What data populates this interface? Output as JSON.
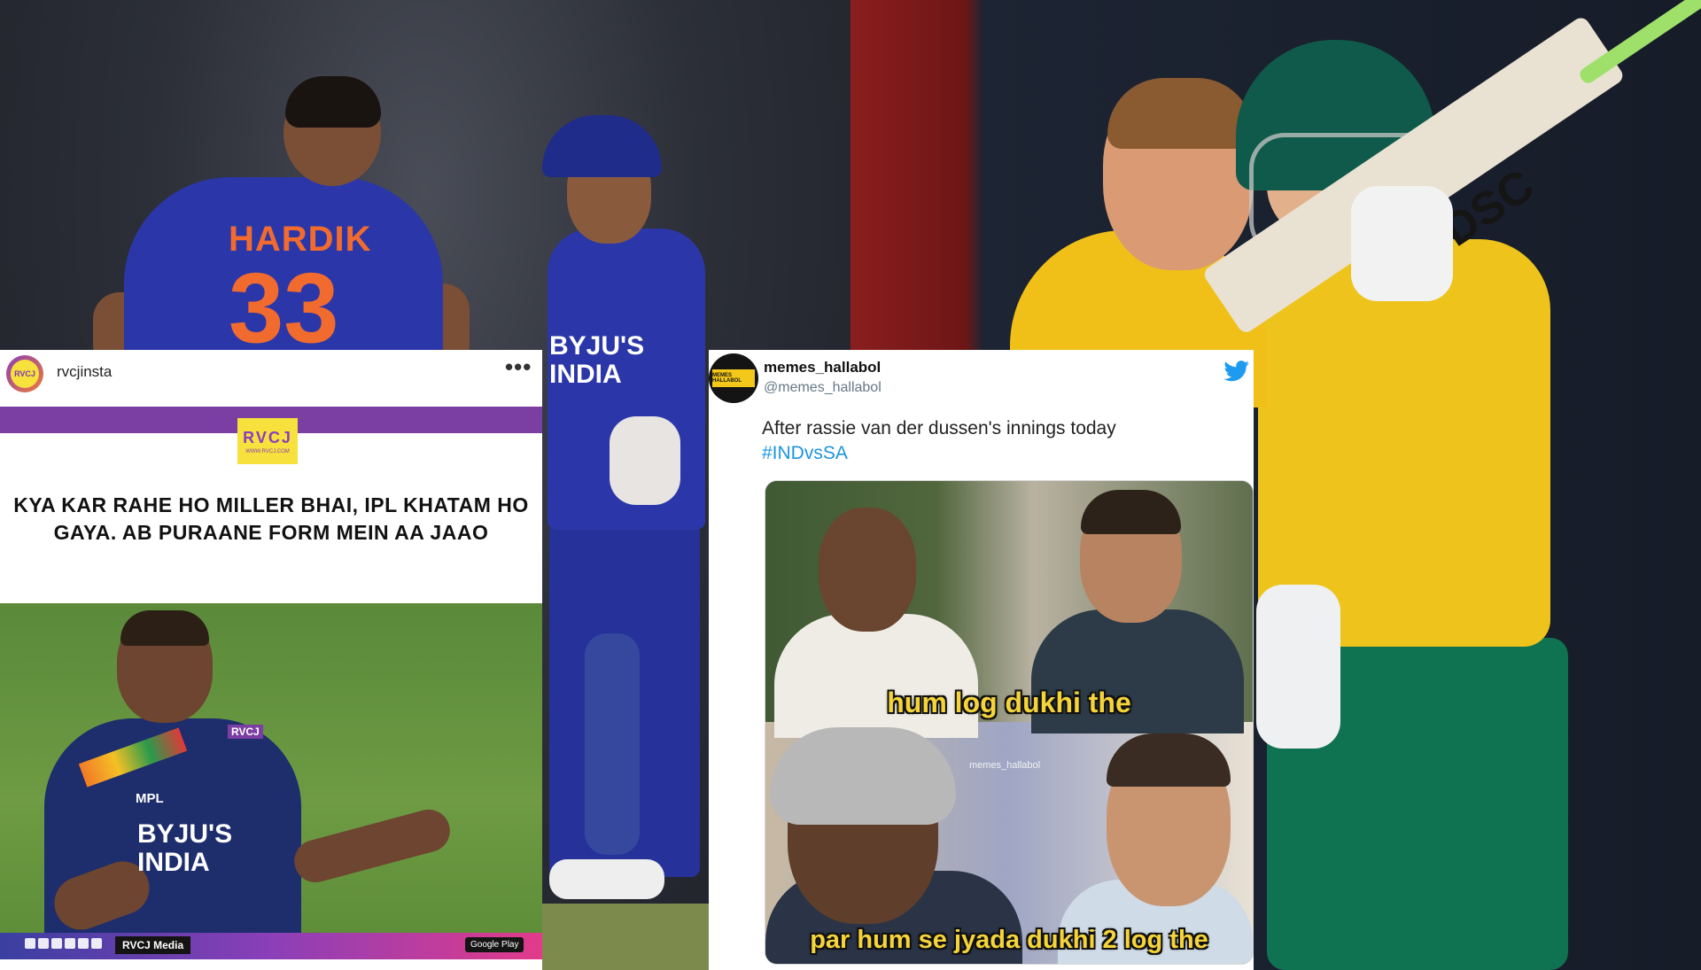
{
  "photos": {
    "left": {
      "jersey_name": "HARDIK",
      "jersey_number": "33",
      "keeper_chest": "BYJU'S\nINDIA"
    },
    "right": {
      "bat_logo": "DSC"
    }
  },
  "instagram_post": {
    "username": "rvcjinsta",
    "avatar_label": "RVCJ",
    "more_icon": "•••",
    "logo_text": "RVCJ",
    "logo_subtext": "WWW.RVCJ.COM",
    "caption": "KYA KAR RAHE HO MILLER BHAI, IPL KHATAM HO GAYA. AB PURAANE FORM MEIN AA JAAO",
    "photo": {
      "mpl": "MPL",
      "byjus": "BYJU'S\nINDIA",
      "watermark": "RVCJ"
    },
    "footer_text": "RVCJ Media",
    "playstore_badge": "Google Play"
  },
  "tweet": {
    "display_name": "memes_hallabol",
    "handle": "@memes_hallabol",
    "avatar_label": "MEMES HALLABOL",
    "text_line1": "After rassie van der dussen's innings today",
    "hashtag": "#INDvsSA",
    "meme": {
      "top_caption": "hum log dukhi the",
      "bottom_caption": "par hum se jyada dukhi 2 log the",
      "watermark": "memes_hallabol"
    }
  },
  "colors": {
    "instagram_purple": "#7b3fa3",
    "rvcj_yellow": "#f7e13d",
    "twitter_blue": "#1b95e0",
    "meme_caption_yellow": "#f5d43a",
    "india_blue": "#2b37a8",
    "sa_yellow": "#f0c019",
    "sa_green": "#0f7352"
  }
}
